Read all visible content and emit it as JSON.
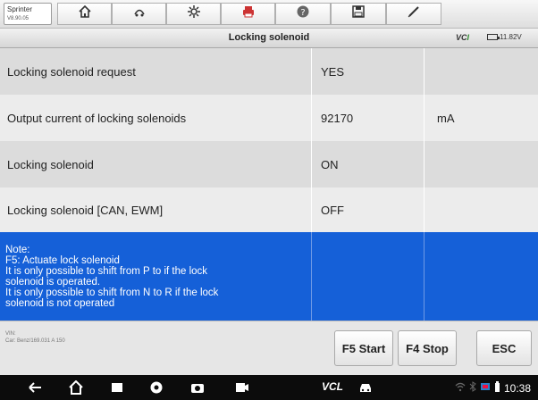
{
  "app": {
    "name": "Sprinter",
    "version": "V8.90.05"
  },
  "toolbar": {
    "buttons": [
      "home-icon",
      "vehicle-swap-icon",
      "settings-gear-icon",
      "print-icon",
      "help-icon",
      "save-icon",
      "pen-icon"
    ]
  },
  "title": "Locking solenoid",
  "vci": {
    "label_a": "VC",
    "label_b": "I",
    "voltage": "11.82V"
  },
  "rows": [
    {
      "name": "Locking solenoid request",
      "value": "YES",
      "unit": ""
    },
    {
      "name": "Output current of locking solenoids",
      "value": "92170",
      "unit": "mA"
    },
    {
      "name": "Locking solenoid",
      "value": "ON",
      "unit": ""
    },
    {
      "name": "Locking solenoid [CAN, EWM]",
      "value": "OFF",
      "unit": ""
    }
  ],
  "note": {
    "lines": [
      "Note:",
      "F5: Actuate lock solenoid",
      "It is only possible to shift from P to if the lock",
      "solenoid is operated.",
      "It is only possible to shift from N to R if the lock",
      "solenoid is not operated"
    ]
  },
  "vehicle": {
    "vin_label": "VIN:",
    "car": "Car: Benz/169.031 A 150"
  },
  "buttons": {
    "f5": "F5 Start",
    "f4": "F4 Stop",
    "esc": "ESC"
  },
  "system_bar": {
    "vcl": "VCL",
    "time": "10:38"
  },
  "colors": {
    "note_bg": "#1560d8",
    "row_odd": "#dcdcdc",
    "row_even": "#ececec"
  }
}
